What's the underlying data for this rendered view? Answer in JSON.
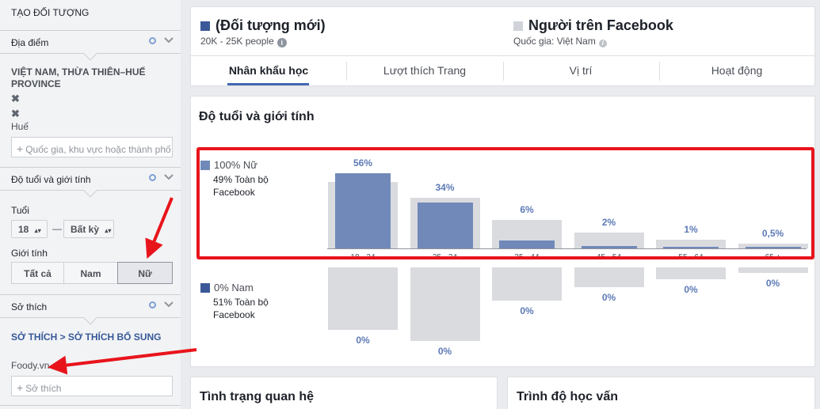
{
  "sidebar": {
    "title": "TẠO ĐỐI TƯỢNG",
    "location": {
      "header": "Địa điểm",
      "place": "VIỆT NAM, THỪA THIÊN–HUẾ PROVINCE",
      "remove_glyph": "✖",
      "city": "Huế",
      "search_placeholder": "Quốc gia, khu vực hoặc thành phố"
    },
    "age_gender": {
      "header": "Độ tuổi và giới tính",
      "age_label": "Tuổi",
      "age_min": "18",
      "age_max": "Bất kỳ",
      "dash": "—",
      "gender_label": "Giới tính",
      "genders": [
        "Tất cả",
        "Nam",
        "Nữ"
      ],
      "selected_gender": "Nữ"
    },
    "interests": {
      "header": "Sở thích",
      "breadcrumb": "SỞ THÍCH > SỞ THÍCH BỔ SUNG",
      "selected": "Foody.vn",
      "search_placeholder": "Sở thích"
    }
  },
  "header": {
    "new_audience": {
      "title": "(Đối tượng mới)",
      "size": "20K - 25K people",
      "color": "#3b5998"
    },
    "facebook_audience": {
      "title": "Người trên Facebook",
      "country": "Quốc gia: Việt Nam",
      "color": "#d0d3d9"
    }
  },
  "tabs": [
    {
      "label": "Nhân khẩu học",
      "active": true
    },
    {
      "label": "Lượt thích Trang",
      "active": false
    },
    {
      "label": "Vị trí",
      "active": false
    },
    {
      "label": "Hoạt động",
      "active": false
    }
  ],
  "demographics": {
    "section_title": "Độ tuổi và giới tính",
    "female": {
      "label": "100% Nữ",
      "sub": "49% Toàn bộ Facebook",
      "color": "#7189b9"
    },
    "male": {
      "label": "0% Nam",
      "sub": "51% Toàn bộ Facebook",
      "color": "#3b5998"
    }
  },
  "chart_data": {
    "type": "bar",
    "categories": [
      "18 - 24",
      "25 - 34",
      "35 - 44",
      "45 - 54",
      "55 - 64",
      "65 +"
    ],
    "series": [
      {
        "name": "Nữ",
        "values": [
          56,
          34,
          6,
          2,
          1,
          0.5
        ],
        "labels": [
          "56%",
          "34%",
          "6%",
          "2%",
          "1%",
          "0,5%"
        ]
      },
      {
        "name": "Nam",
        "values": [
          0,
          0,
          0,
          0,
          0,
          0
        ],
        "labels": [
          "0%",
          "0%",
          "0%",
          "0%",
          "0%",
          "0%"
        ]
      }
    ],
    "baseline_female": [
      30,
      23,
      13,
      7,
      4,
      2
    ],
    "baseline_male": [
      32,
      38,
      17,
      10,
      6,
      3
    ],
    "title": "Độ tuổi và giới tính",
    "xlabel": "",
    "ylabel": "",
    "ylim": [
      0,
      60
    ]
  },
  "bottom": {
    "relationship_title": "Tình trạng quan hệ",
    "education_title": "Trình độ học vấn"
  }
}
